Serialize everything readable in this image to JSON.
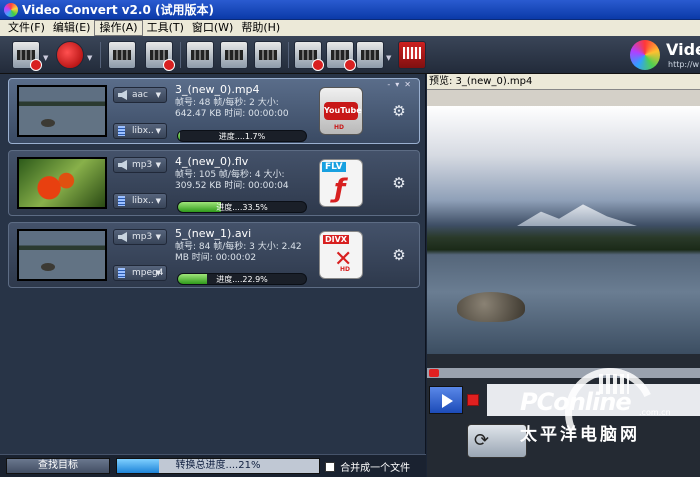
{
  "window": {
    "title": "Video Convert v2.0 (试用版本)"
  },
  "menu": [
    {
      "label": "文件(F)",
      "active": false
    },
    {
      "label": "编辑(E)",
      "active": false
    },
    {
      "label": "操作(A)",
      "active": true
    },
    {
      "label": "工具(T)",
      "active": false
    },
    {
      "label": "窗口(W)",
      "active": false
    },
    {
      "label": "帮助(H)",
      "active": false
    }
  ],
  "toolbar": {
    "icons": [
      "add-video-icon",
      "youtube-icon",
      "clip-icon",
      "trim-icon",
      "effect-icon",
      "edit-icon",
      "info-icon",
      "add-to-list-icon",
      "convert-icon",
      "tv-icon",
      "percent-icon"
    ]
  },
  "brand": {
    "name": "Vide",
    "url": "http://w"
  },
  "files": [
    {
      "name": "3_(new_0).mp4",
      "audio": "aac",
      "video": "libx..",
      "info": "帧号: 48 帧/每秒: 2 大小: 642.47 KB 时间: 00:00:00",
      "progress_label": "进度....1.7%",
      "progress": 1.7,
      "format": "YouTube",
      "format_sub": "HD"
    },
    {
      "name": "4_(new_0).flv",
      "audio": "mp3",
      "video": "libx..",
      "info": "帧号: 105 帧/每秒: 4 大小: 309.52 KB 时间: 00:00:04",
      "progress_label": "进度....33.5%",
      "progress": 33.5,
      "format": "FLV",
      "format_sub": ""
    },
    {
      "name": "5_(new_1).avi",
      "audio": "mp3",
      "video": "mpeg4",
      "info": "帧号: 84 帧/每秒: 3 大小: 2.42 MB 时间: 00:00:02",
      "progress_label": "进度....22.9%",
      "progress": 22.9,
      "format": "DIVX",
      "format_sub": "HD"
    }
  ],
  "bottom": {
    "find_target": "查找目标",
    "total_progress_label": "转换总进度....21%",
    "total_progress": 21,
    "merge_label": "合并成一个文件"
  },
  "preview": {
    "title": "预览: 3_(new_0).mp4"
  },
  "watermark": {
    "logo": "PConline",
    "sub": ".com.cn",
    "cn": "太平洋电脑网"
  }
}
